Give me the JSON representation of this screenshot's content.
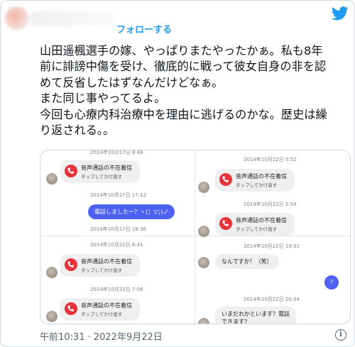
{
  "header": {
    "follow_label": "フォローする"
  },
  "tweet": {
    "lines": [
      "山田遥楓選手の嫁、やっぱりまたやったかぁ。私も8年",
      "前に誹謗中傷を受け、徹底的に戦って彼女自身の非を認",
      "めて反省したはずなんだけどなぁ。",
      "また同じ事やってるよ。",
      "今回も心療内科治療中を理由に逃げるのかな。歴史は繰",
      "り返される。。"
    ]
  },
  "screenshot": {
    "left_top": {
      "ts1": "2014年10月17日 8:48",
      "missed_title": "音声通話の不在着信",
      "missed_sub": "タップしてかけ直す",
      "ts2": "2014年10月17日 17:12",
      "sent": "電話しましたー？ヽ(；▽；)ノ",
      "ts3": "2014年10月17日 18:36"
    },
    "right_top": {
      "ts1": "2014年10月22日 5:52",
      "missed1_title": "音声通話の不在着信",
      "missed1_sub": "タップしてかけ直す",
      "ts2": "2014年10月22日 5:54",
      "missed2_title": "音声通話の不在着信",
      "missed2_sub": "タップしてかけ直す"
    },
    "left_bottom": {
      "ts1": "2014年10月22日 6:41",
      "missed1_title": "音声通話の不在着信",
      "missed1_sub": "タップしてかけ直す",
      "ts2": "2014年10月22日 7:06",
      "missed2_title": "音声通話の不在着信",
      "missed2_sub": "タップしてかけ直す"
    },
    "right_bottom": {
      "ts1": "2014年10月22日 19:31",
      "received": "なんですか！（笑）",
      "sent": "?",
      "ts2": "2014年10月22日 20:04",
      "received2_line1": "いまだれかといます？電話",
      "received2_line2": "できます？"
    }
  },
  "footer": {
    "timestamp": "午前10:31 · 2022年9月22日",
    "info": "i"
  },
  "colors": {
    "twitter_blue": "#1d9bf0",
    "missed_call_red": "#e8323a",
    "sent_bubble_blue": "#4d61f3"
  },
  "icons": [
    "twitter-bird-icon",
    "missed-call-icon",
    "info-icon"
  ]
}
